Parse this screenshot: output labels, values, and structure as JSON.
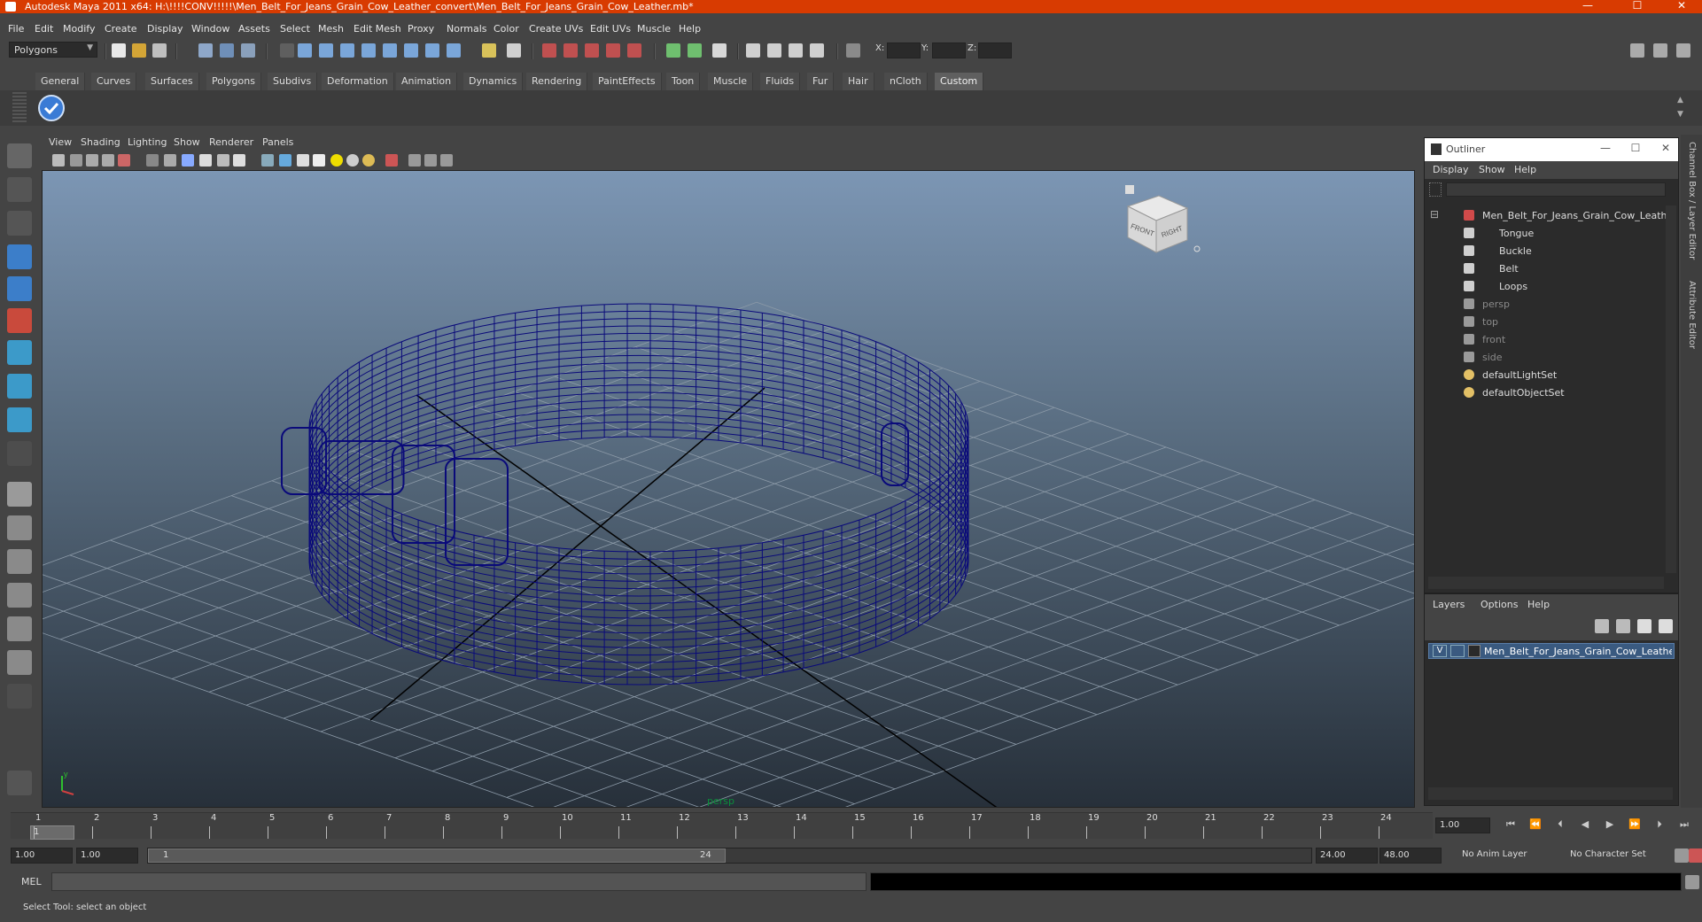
{
  "window": {
    "title": "Autodesk Maya 2011 x64: H:\\!!!!CONV!!!!!\\Men_Belt_For_Jeans_Grain_Cow_Leather_convert\\Men_Belt_For_Jeans_Grain_Cow_Leather.mb*",
    "minimize": "—",
    "maximize": "☐",
    "close": "✕"
  },
  "menus": [
    "File",
    "Edit",
    "Modify",
    "Create",
    "Display",
    "Window",
    "Assets",
    "Select",
    "Mesh",
    "Edit Mesh",
    "Proxy",
    "Normals",
    "Color",
    "Create UVs",
    "Edit UVs",
    "Muscle",
    "Help"
  ],
  "status_line": {
    "mode": "Polygons",
    "x_label": "X:",
    "y_label": "Y:",
    "z_label": "Z:"
  },
  "shelf_tabs": [
    "General",
    "Curves",
    "Surfaces",
    "Polygons",
    "Subdivs",
    "Deformation",
    "Animation",
    "Dynamics",
    "Rendering",
    "PaintEffects",
    "Toon",
    "Muscle",
    "Fluids",
    "Fur",
    "Hair",
    "nCloth",
    "Custom"
  ],
  "active_shelf_tab": "Custom",
  "viewport": {
    "menus": [
      "View",
      "Shading",
      "Lighting",
      "Show",
      "Renderer",
      "Panels"
    ],
    "camera_label": "persp",
    "viewcube_front": "FRONT",
    "viewcube_right": "RIGHT",
    "wire_color": "#0a0a7a"
  },
  "outliner": {
    "title": "Outliner",
    "menus": [
      "Display",
      "Show",
      "Help"
    ],
    "items": [
      {
        "label": "Men_Belt_For_Jeans_Grain_Cow_Leath",
        "indent": 0,
        "kind": "group",
        "dim": false
      },
      {
        "label": "Tongue",
        "indent": 1,
        "kind": "mesh",
        "dim": false
      },
      {
        "label": "Buckle",
        "indent": 1,
        "kind": "mesh",
        "dim": false
      },
      {
        "label": "Belt",
        "indent": 1,
        "kind": "mesh",
        "dim": false
      },
      {
        "label": "Loops",
        "indent": 1,
        "kind": "mesh",
        "dim": false
      },
      {
        "label": "persp",
        "indent": 0,
        "kind": "camera",
        "dim": true
      },
      {
        "label": "top",
        "indent": 0,
        "kind": "camera",
        "dim": true
      },
      {
        "label": "front",
        "indent": 0,
        "kind": "camera",
        "dim": true
      },
      {
        "label": "side",
        "indent": 0,
        "kind": "camera",
        "dim": true
      },
      {
        "label": "defaultLightSet",
        "indent": 0,
        "kind": "set",
        "dim": false
      },
      {
        "label": "defaultObjectSet",
        "indent": 0,
        "kind": "set",
        "dim": false
      }
    ]
  },
  "layers": {
    "menus": [
      "Layers",
      "Options",
      "Help"
    ],
    "layer_name": "Men_Belt_For_Jeans_Grain_Cow_Leather_",
    "visible_flag": "V"
  },
  "side_tabs": [
    "Channel Box / Layer Editor",
    "Attribute Editor"
  ],
  "timeline": {
    "ticks": [
      1,
      2,
      3,
      4,
      5,
      6,
      7,
      8,
      9,
      10,
      11,
      12,
      13,
      14,
      15,
      16,
      17,
      18,
      19,
      20,
      21,
      22,
      23,
      24
    ],
    "current_frame": "1",
    "current_field": "1.00"
  },
  "range": {
    "start": "1.00",
    "start2": "1.00",
    "slider_start": "1",
    "slider_end": "24",
    "end": "24.00",
    "end2": "48.00",
    "anim_layer": "No Anim Layer",
    "char_set": "No Character Set"
  },
  "command_line": {
    "label": "MEL"
  },
  "help_line": "Select Tool: select an object"
}
